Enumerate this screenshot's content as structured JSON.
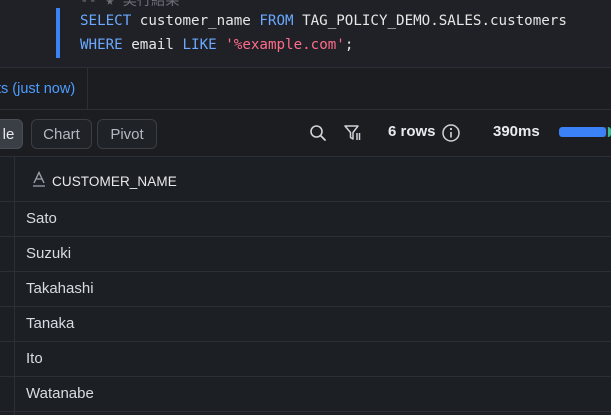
{
  "editor": {
    "comment_line": "-- ★ 実行結果",
    "line1": {
      "kw1": "SELECT",
      "t1": " customer_name ",
      "kw2": "FROM",
      "t2": " TAG_POLICY_DEMO.SALES.customers"
    },
    "line2": {
      "kw1": "WHERE",
      "t1": " email ",
      "kw2": "LIKE",
      "t2": " ",
      "str": "'%example.com'",
      "t3": ";"
    }
  },
  "results_tab": {
    "label": "ts (just now)"
  },
  "toolbar": {
    "table_label": "le",
    "chart_label": "Chart",
    "pivot_label": "Pivot",
    "rows_count": "6 rows",
    "duration": "390ms",
    "progress_fraction": 0.9
  },
  "grid": {
    "column": {
      "type_icon": "A",
      "name": "CUSTOMER_NAME"
    },
    "rows": [
      "Sato",
      "Suzuki",
      "Takahashi",
      "Tanaka",
      "Ito",
      "Watanabe"
    ]
  },
  "colors": {
    "accent": "#3b82f6",
    "keyword": "#6aa9ff",
    "string": "#ff6b8a",
    "link": "#4e9dff"
  }
}
